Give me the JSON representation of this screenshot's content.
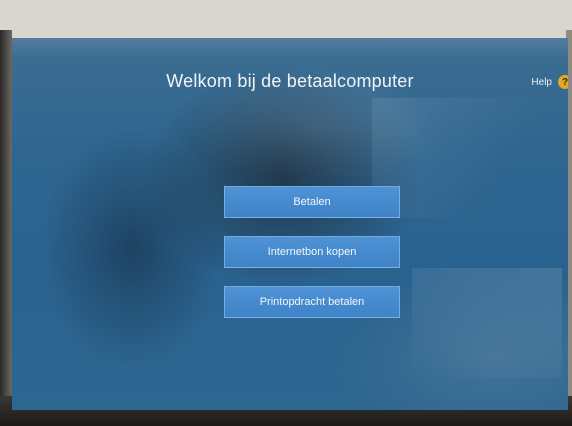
{
  "screen": {
    "title": "Welkom bij de betaalcomputer",
    "help_label": "Help",
    "help_icon": "help-icon"
  },
  "menu": {
    "buttons": [
      {
        "label": "Betalen"
      },
      {
        "label": "Internetbon kopen"
      },
      {
        "label": "Printopdracht betalen"
      }
    ]
  },
  "colors": {
    "background": "#2a628f",
    "button": "#4a8fd4",
    "help_icon": "#e0a825"
  }
}
